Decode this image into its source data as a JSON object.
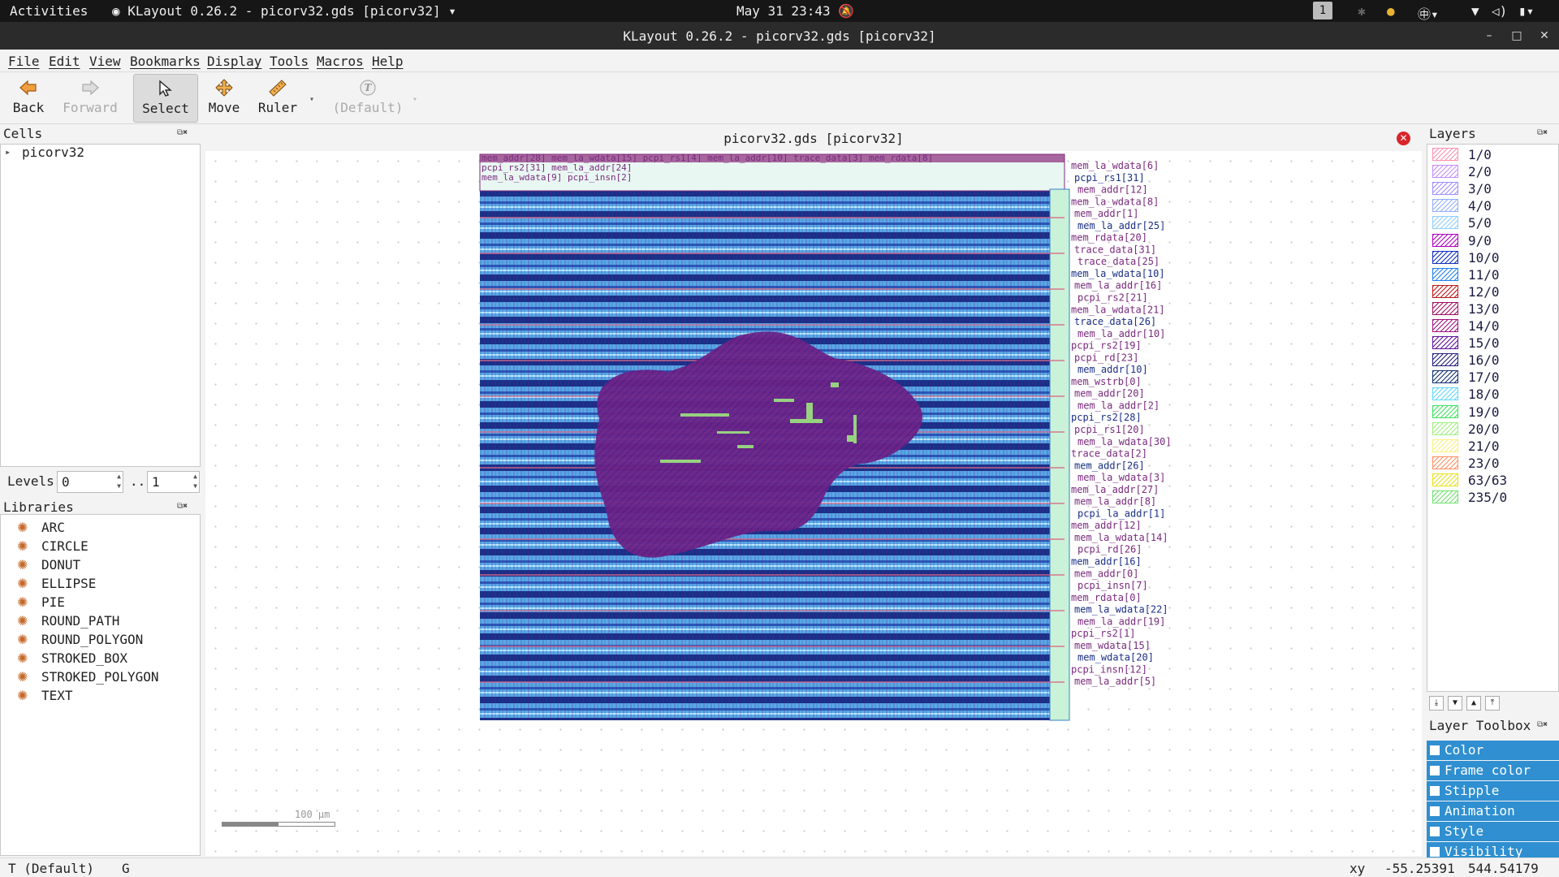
{
  "system_bar": {
    "activities": "Activities",
    "app_indicator": "KLayout 0.26.2 - picorv32.gds [picorv32]",
    "clock": "May 31 23:43",
    "workspace": "1"
  },
  "window": {
    "title": "KLayout 0.26.2 - picorv32.gds [picorv32]"
  },
  "menu": [
    "File",
    "Edit",
    "View",
    "Bookmarks",
    "Display",
    "Tools",
    "Macros",
    "Help"
  ],
  "toolbar": {
    "back": "Back",
    "forward": "Forward",
    "select": "Select",
    "move": "Move",
    "ruler": "Ruler",
    "default": "(Default)"
  },
  "cells": {
    "title": "Cells",
    "items": [
      "picorv32"
    ]
  },
  "levels": {
    "label": "Levels",
    "from": "0",
    "separator": "..",
    "to": "1"
  },
  "libraries": {
    "title": "Libraries",
    "items": [
      "ARC",
      "CIRCLE",
      "DONUT",
      "ELLIPSE",
      "PIE",
      "ROUND_PATH",
      "ROUND_POLYGON",
      "STROKED_BOX",
      "STROKED_POLYGON",
      "TEXT"
    ]
  },
  "canvas": {
    "tab_title": "picorv32.gds [picorv32]",
    "scale_label": "100 µm",
    "net_labels": [
      "mem_la_wdata[6]",
      "pcpi_rs1[31]",
      "mem_addr[12]",
      "mem_la_wdata[8]",
      "mem_addr[1]",
      "mem_la_addr[25]",
      "mem_rdata[20]",
      "trace_data[31]",
      "trace_data[25]",
      "mem_la_wdata[10]",
      "mem_la_addr[16]",
      "pcpi_rs2[21]",
      "mem_la_wdata[21]",
      "trace_data[26]",
      "mem_la_addr[10]",
      "pcpi_rs2[19]",
      "pcpi_rd[23]",
      "mem_addr[10]",
      "mem_wstrb[0]",
      "mem_addr[20]",
      "mem_la_addr[2]",
      "pcpi_rs2[28]",
      "pcpi_rs1[20]",
      "mem_la_wdata[30]",
      "trace_data[2]",
      "mem_addr[26]",
      "mem_la_wdata[3]",
      "mem_la_addr[27]",
      "mem_la_addr[8]",
      "pcpi_la_addr[1]",
      "mem_addr[12]",
      "mem_la_wdata[14]",
      "pcpi_rd[26]",
      "mem_addr[16]",
      "mem_addr[0]",
      "pcpi_insn[7]",
      "mem_rdata[0]",
      "mem_la_wdata[22]",
      "mem_la_addr[19]",
      "pcpi_rs2[1]",
      "mem_wdata[15]",
      "mem_wdata[20]",
      "pcpi_insn[12]",
      "mem_la_addr[5]"
    ]
  },
  "layers": {
    "title": "Layers",
    "items": [
      {
        "name": "1/0",
        "color": "#ff8fb0"
      },
      {
        "name": "2/0",
        "color": "#c38fff"
      },
      {
        "name": "3/0",
        "color": "#9f8fff"
      },
      {
        "name": "4/0",
        "color": "#8faeff"
      },
      {
        "name": "5/0",
        "color": "#8fcfff"
      },
      {
        "name": "9/0",
        "color": "#b000c0"
      },
      {
        "name": "10/0",
        "color": "#1030c0"
      },
      {
        "name": "11/0",
        "color": "#2080f0"
      },
      {
        "name": "12/0",
        "color": "#c01818"
      },
      {
        "name": "13/0",
        "color": "#a01060"
      },
      {
        "name": "14/0",
        "color": "#a01080"
      },
      {
        "name": "15/0",
        "color": "#6010a0"
      },
      {
        "name": "16/0",
        "color": "#202080"
      },
      {
        "name": "17/0",
        "color": "#103070"
      },
      {
        "name": "18/0",
        "color": "#60d8ff"
      },
      {
        "name": "19/0",
        "color": "#40e060"
      },
      {
        "name": "20/0",
        "color": "#a0f080"
      },
      {
        "name": "21/0",
        "color": "#f8f080"
      },
      {
        "name": "23/0",
        "color": "#ff9060"
      },
      {
        "name": "63/63",
        "color": "#e8e020"
      },
      {
        "name": "235/0",
        "color": "#70e070"
      }
    ]
  },
  "layer_toolbox": {
    "title": "Layer Toolbox",
    "items": [
      "Color",
      "Frame color",
      "Stipple",
      "Animation",
      "Style",
      "Visibility"
    ]
  },
  "status": {
    "mode": "T (Default)",
    "grid": "G",
    "coord_label": "xy",
    "x": "-55.25391",
    "y": "544.54179"
  }
}
